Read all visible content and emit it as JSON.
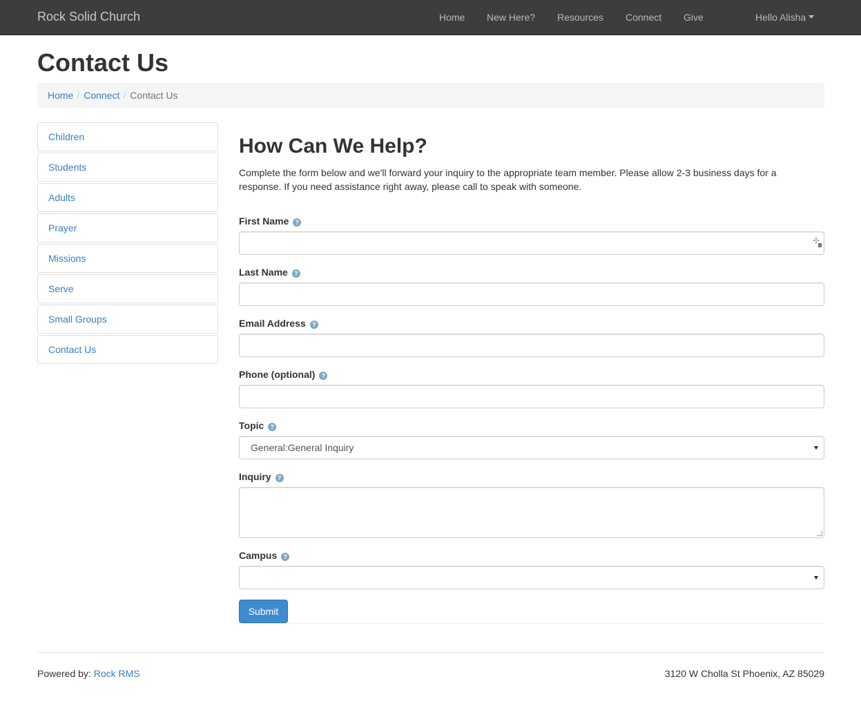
{
  "navbar": {
    "brand": "Rock Solid Church",
    "links": [
      "Home",
      "New Here?",
      "Resources",
      "Connect",
      "Give"
    ],
    "user_menu": "Hello Alisha"
  },
  "page": {
    "title": "Contact Us",
    "breadcrumb": [
      "Home",
      "Connect",
      "Contact Us"
    ]
  },
  "sidebar": {
    "items": [
      "Children",
      "Students",
      "Adults",
      "Prayer",
      "Missions",
      "Serve",
      "Small Groups",
      "Contact Us"
    ]
  },
  "form": {
    "heading": "How Can We Help?",
    "intro": "Complete the form below and we'll forward your inquiry to the appropriate team member. Please allow 2-3 business days for a response. If you need assistance right away, please call to speak with someone.",
    "help_glyph": "?",
    "fields": {
      "first_name": {
        "label": "First Name",
        "value": ""
      },
      "last_name": {
        "label": "Last Name",
        "value": ""
      },
      "email": {
        "label": "Email Address",
        "value": ""
      },
      "phone": {
        "label": "Phone (optional)",
        "value": ""
      },
      "topic": {
        "label": "Topic",
        "value": "General:General Inquiry"
      },
      "inquiry": {
        "label": "Inquiry",
        "value": ""
      },
      "campus": {
        "label": "Campus",
        "value": ""
      }
    },
    "submit_label": "Submit"
  },
  "footer": {
    "powered_by_label": "Powered by:",
    "powered_by_link": "Rock RMS",
    "address": "3120 W Cholla St Phoenix, AZ 85029"
  },
  "colors": {
    "navbar_bg": "#3d3d3d",
    "link": "#3b7dc4",
    "primary_button": "#3f8bd0",
    "help_icon": "#7ea7c3"
  }
}
